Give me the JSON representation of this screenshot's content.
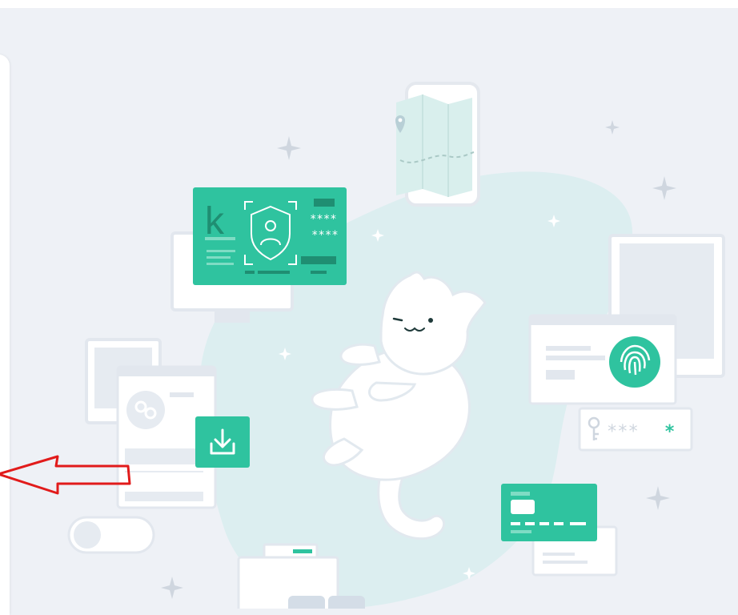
{
  "illustration": {
    "id_card_letter": "k",
    "pin_mask_1": "****",
    "pin_mask_2": "****",
    "password_mask": "***",
    "password_last": "*"
  },
  "colors": {
    "background": "#eef1f6",
    "accent": "#2fc39f",
    "blob": "#dceef0",
    "annotation_arrow": "#e11b1b"
  },
  "icons": [
    "map-pin-icon",
    "shield-user-icon",
    "fingerprint-icon",
    "key-icon",
    "download-icon",
    "link-icon",
    "credit-card-icon",
    "toggle-icon",
    "sparkle-icon",
    "cat-icon",
    "red-arrow-icon"
  ]
}
